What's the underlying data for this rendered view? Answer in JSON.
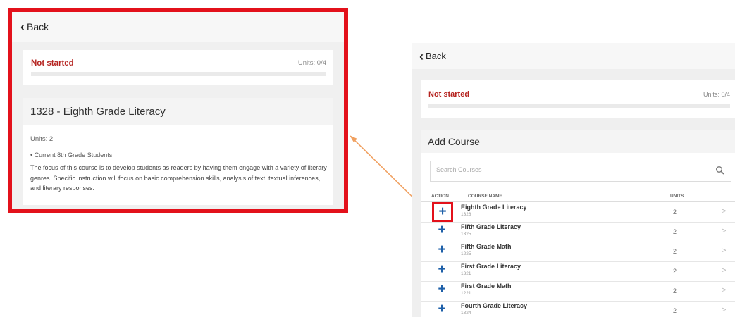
{
  "callout": {
    "back_label": "Back",
    "status": "Not started",
    "units_progress": "Units: 0/4",
    "progress": 0,
    "course_title": "1328 - Eighth Grade Literacy",
    "course_units": "Units: 2",
    "bullet": "• Current 8th Grade Students",
    "description": "The focus of this course is to develop students as readers by having them engage with a variety of literary genres. Specific instruction will focus on basic comprehension skills, analysis of text, textual inferences, and literary responses."
  },
  "screen": {
    "back_label": "Back",
    "status": "Not started",
    "units_progress": "Units: 0/4",
    "progress": 0,
    "add_course_title": "Add Course",
    "search_placeholder": "Search Courses",
    "columns": {
      "action": "ACTION",
      "course_name": "COURSE NAME",
      "units": "UNITS"
    },
    "courses": [
      {
        "name": "Eighth Grade Literacy",
        "code": "1328",
        "units": "2"
      },
      {
        "name": "Fifth Grade Literacy",
        "code": "1325",
        "units": "2"
      },
      {
        "name": "Fifth Grade Math",
        "code": "1225",
        "units": "2"
      },
      {
        "name": "First Grade Literacy",
        "code": "1321",
        "units": "2"
      },
      {
        "name": "First Grade Math",
        "code": "1221",
        "units": "2"
      },
      {
        "name": "Fourth Grade Literacy",
        "code": "1324",
        "units": "2"
      }
    ]
  },
  "colors": {
    "highlight": "#e3111b",
    "status": "#b5231f",
    "action": "#1d5fa8",
    "arrow": "#f0a060"
  }
}
